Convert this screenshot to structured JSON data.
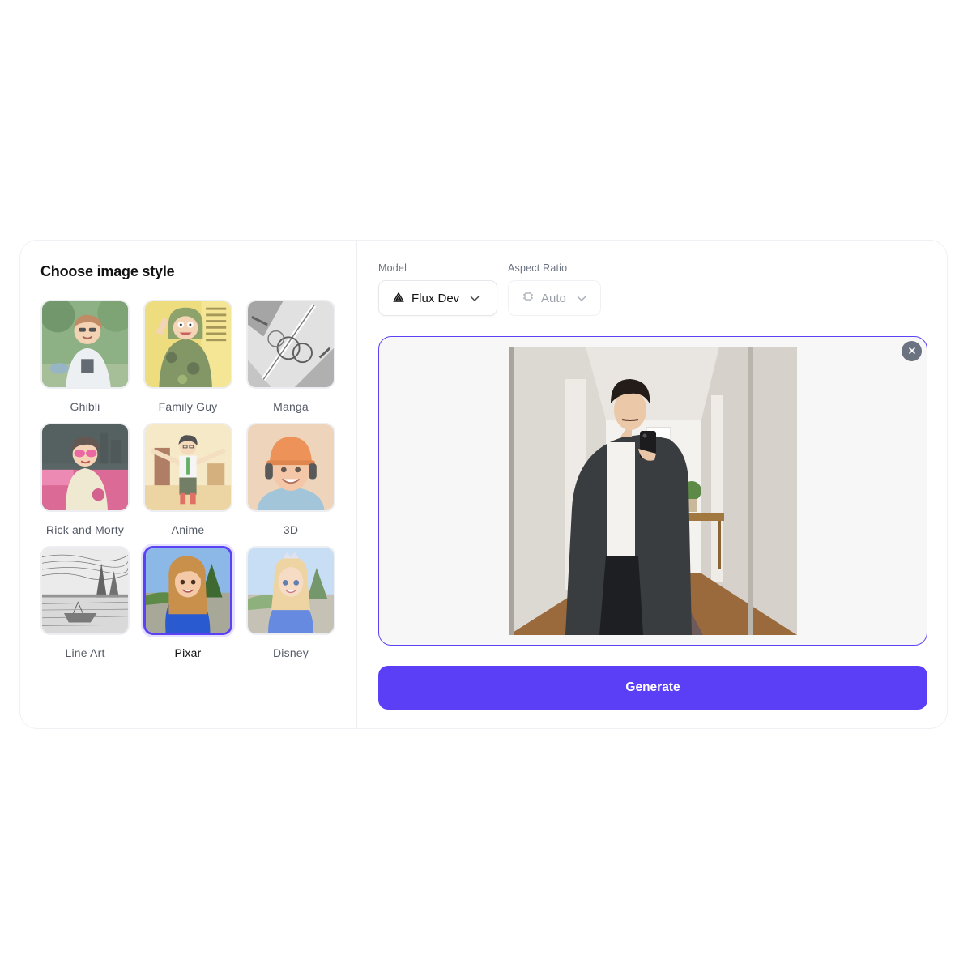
{
  "style_panel": {
    "title": "Choose image style",
    "styles": [
      {
        "label": "Ghibli",
        "selected": false
      },
      {
        "label": "Family Guy",
        "selected": false
      },
      {
        "label": "Manga",
        "selected": false
      },
      {
        "label": "Rick and Morty",
        "selected": false
      },
      {
        "label": "Anime",
        "selected": false
      },
      {
        "label": "3D",
        "selected": false
      },
      {
        "label": "Line Art",
        "selected": false
      },
      {
        "label": "Pixar",
        "selected": true
      },
      {
        "label": "Disney",
        "selected": false
      }
    ]
  },
  "controls": {
    "model_label": "Model",
    "model_value": "Flux Dev",
    "model_icon": "flux-logo-icon",
    "aspect_label": "Aspect Ratio",
    "aspect_value": "Auto",
    "aspect_icon": "crop-frame-icon"
  },
  "upload": {
    "remove_icon": "close-icon"
  },
  "actions": {
    "generate_label": "Generate"
  },
  "colors": {
    "accent": "#5b3ff7",
    "selected_border": "#5b43f5",
    "text_primary": "#111111",
    "text_muted": "#6b7280"
  }
}
